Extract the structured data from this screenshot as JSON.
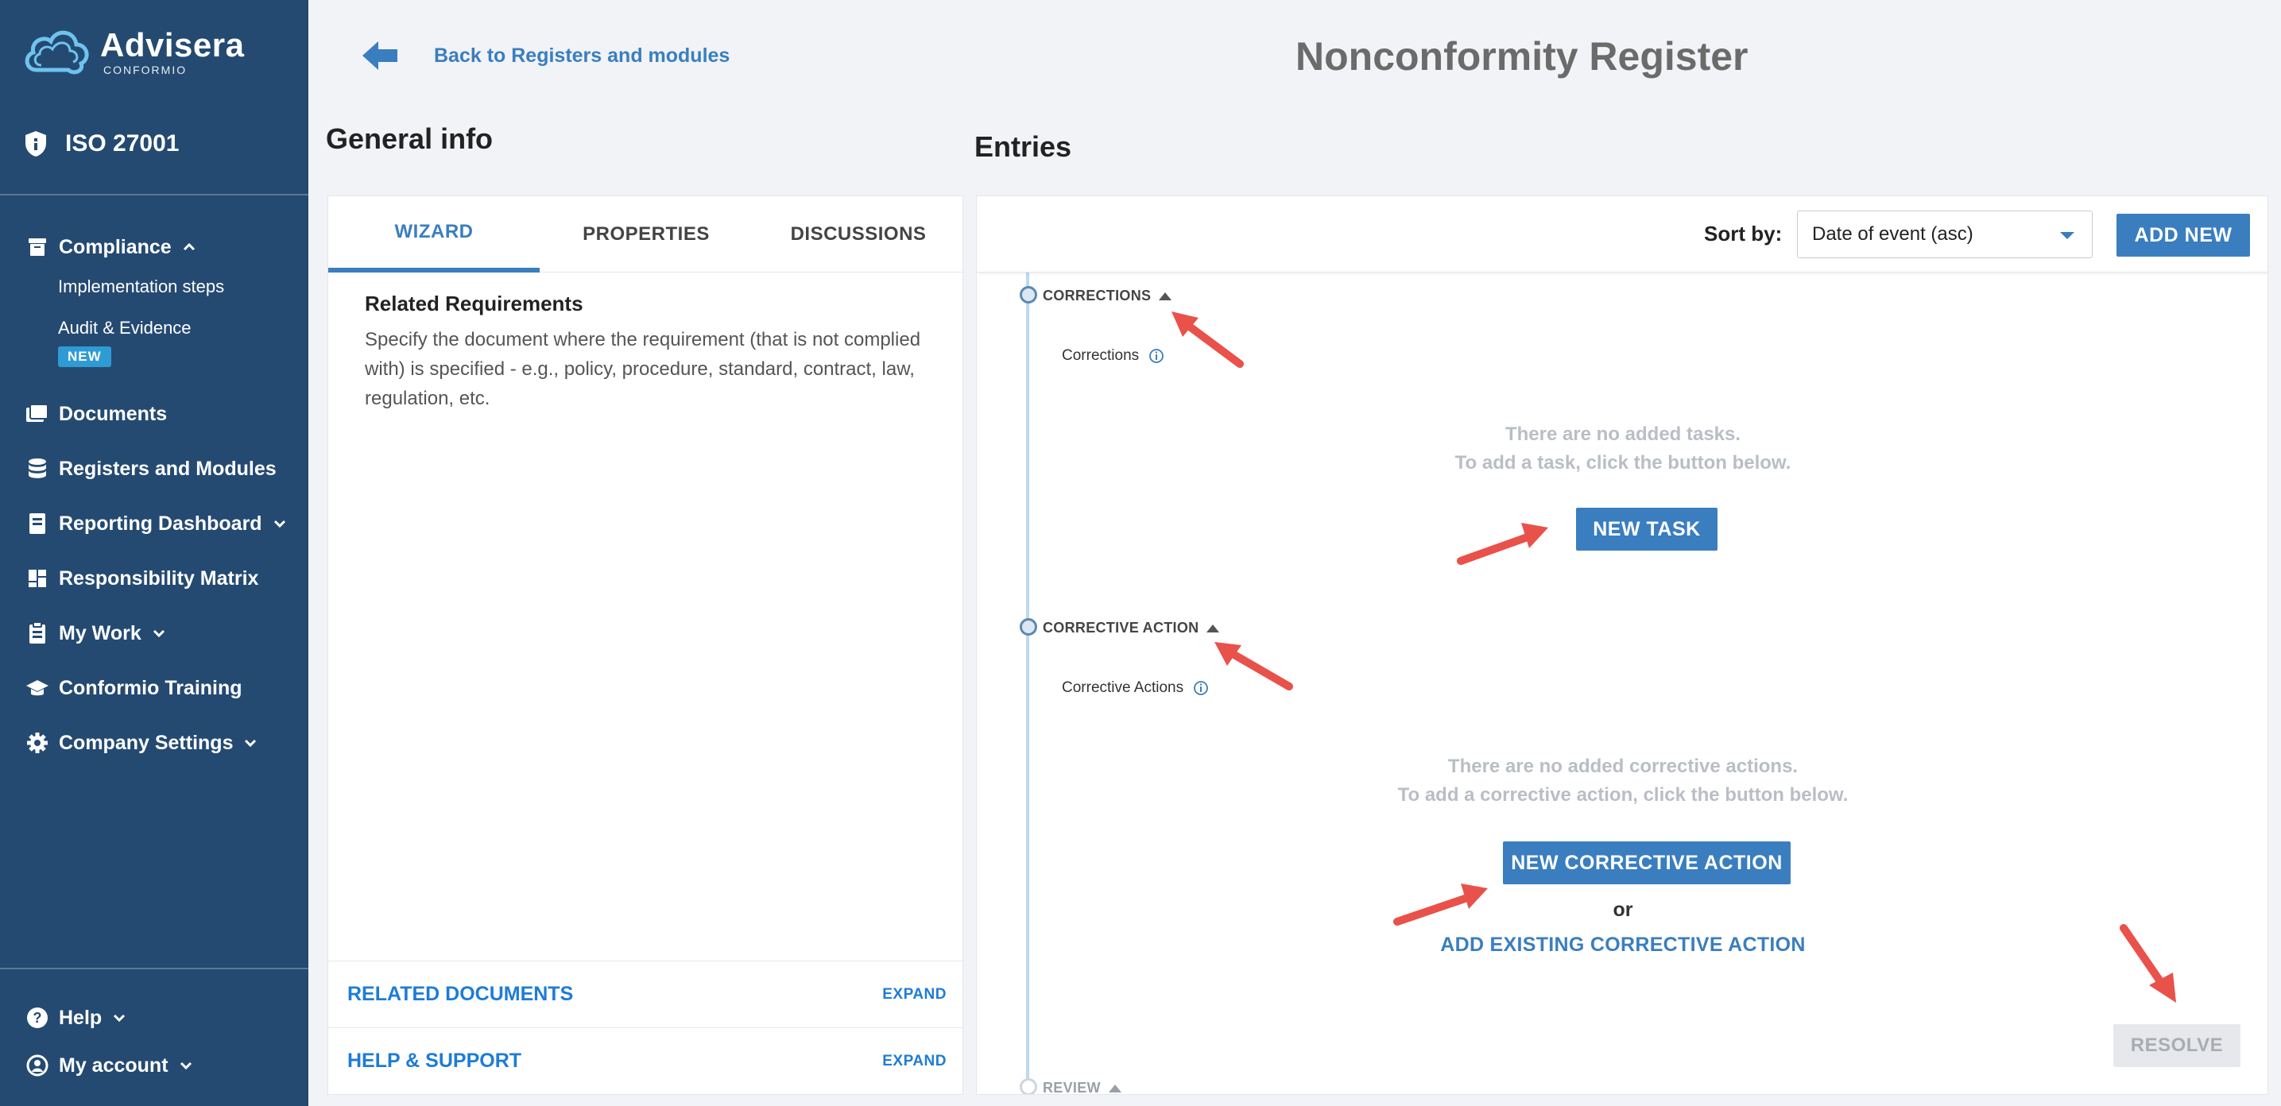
{
  "brand": {
    "name": "Advisera",
    "sub": "CONFORMIO"
  },
  "standard": "ISO 27001",
  "sidebar": {
    "compliance": {
      "label": "Compliance",
      "children": [
        "Implementation steps",
        "Audit & Evidence"
      ],
      "new_badge": "NEW"
    },
    "items": [
      {
        "label": "Documents",
        "icon": "folder-icon"
      },
      {
        "label": "Registers and Modules",
        "icon": "database-icon"
      },
      {
        "label": "Reporting Dashboard",
        "icon": "report-icon"
      },
      {
        "label": "Responsibility Matrix",
        "icon": "grid-icon"
      },
      {
        "label": "My Work",
        "icon": "clipboard-icon"
      },
      {
        "label": "Conformio Training",
        "icon": "graduation-cap-icon"
      },
      {
        "label": "Company Settings",
        "icon": "gear-icon"
      }
    ],
    "help": "Help",
    "account": "My account"
  },
  "header": {
    "back_label": "Back to Registers and modules",
    "title": "Nonconformity Register"
  },
  "general": {
    "heading": "General info",
    "tabs": [
      "WIZARD",
      "PROPERTIES",
      "DISCUSSIONS"
    ],
    "related_title": "Related Requirements",
    "related_desc": "Specify the document where the requirement (that is not complied with) is specified - e.g., policy, procedure, standard, contract, law, regulation, etc.",
    "accordions": [
      {
        "label": "RELATED DOCUMENTS",
        "action": "EXPAND"
      },
      {
        "label": "HELP & SUPPORT",
        "action": "EXPAND"
      }
    ]
  },
  "entries": {
    "heading": "Entries",
    "sort_label": "Sort by:",
    "sort_value": "Date of event (asc)",
    "add_new": "ADD NEW",
    "corrections": {
      "section": "CORRECTIONS",
      "sub": "Corrections",
      "empty_line1": "There are no added tasks.",
      "empty_line2": "To add a task, click the button below.",
      "button": "NEW TASK"
    },
    "corrective": {
      "section": "CORRECTIVE ACTION",
      "sub": "Corrective Actions",
      "empty_line1": "There are no added corrective actions.",
      "empty_line2": "To add a corrective action, click the button below.",
      "button": "NEW CORRECTIVE ACTION",
      "or": "or",
      "existing": "ADD EXISTING CORRECTIVE ACTION"
    },
    "resolve": "RESOLVE",
    "review": "REVIEW"
  },
  "colors": {
    "sidebar": "#244a72",
    "accent": "#3a7ebf",
    "annotation_arrow": "#e8524a"
  }
}
